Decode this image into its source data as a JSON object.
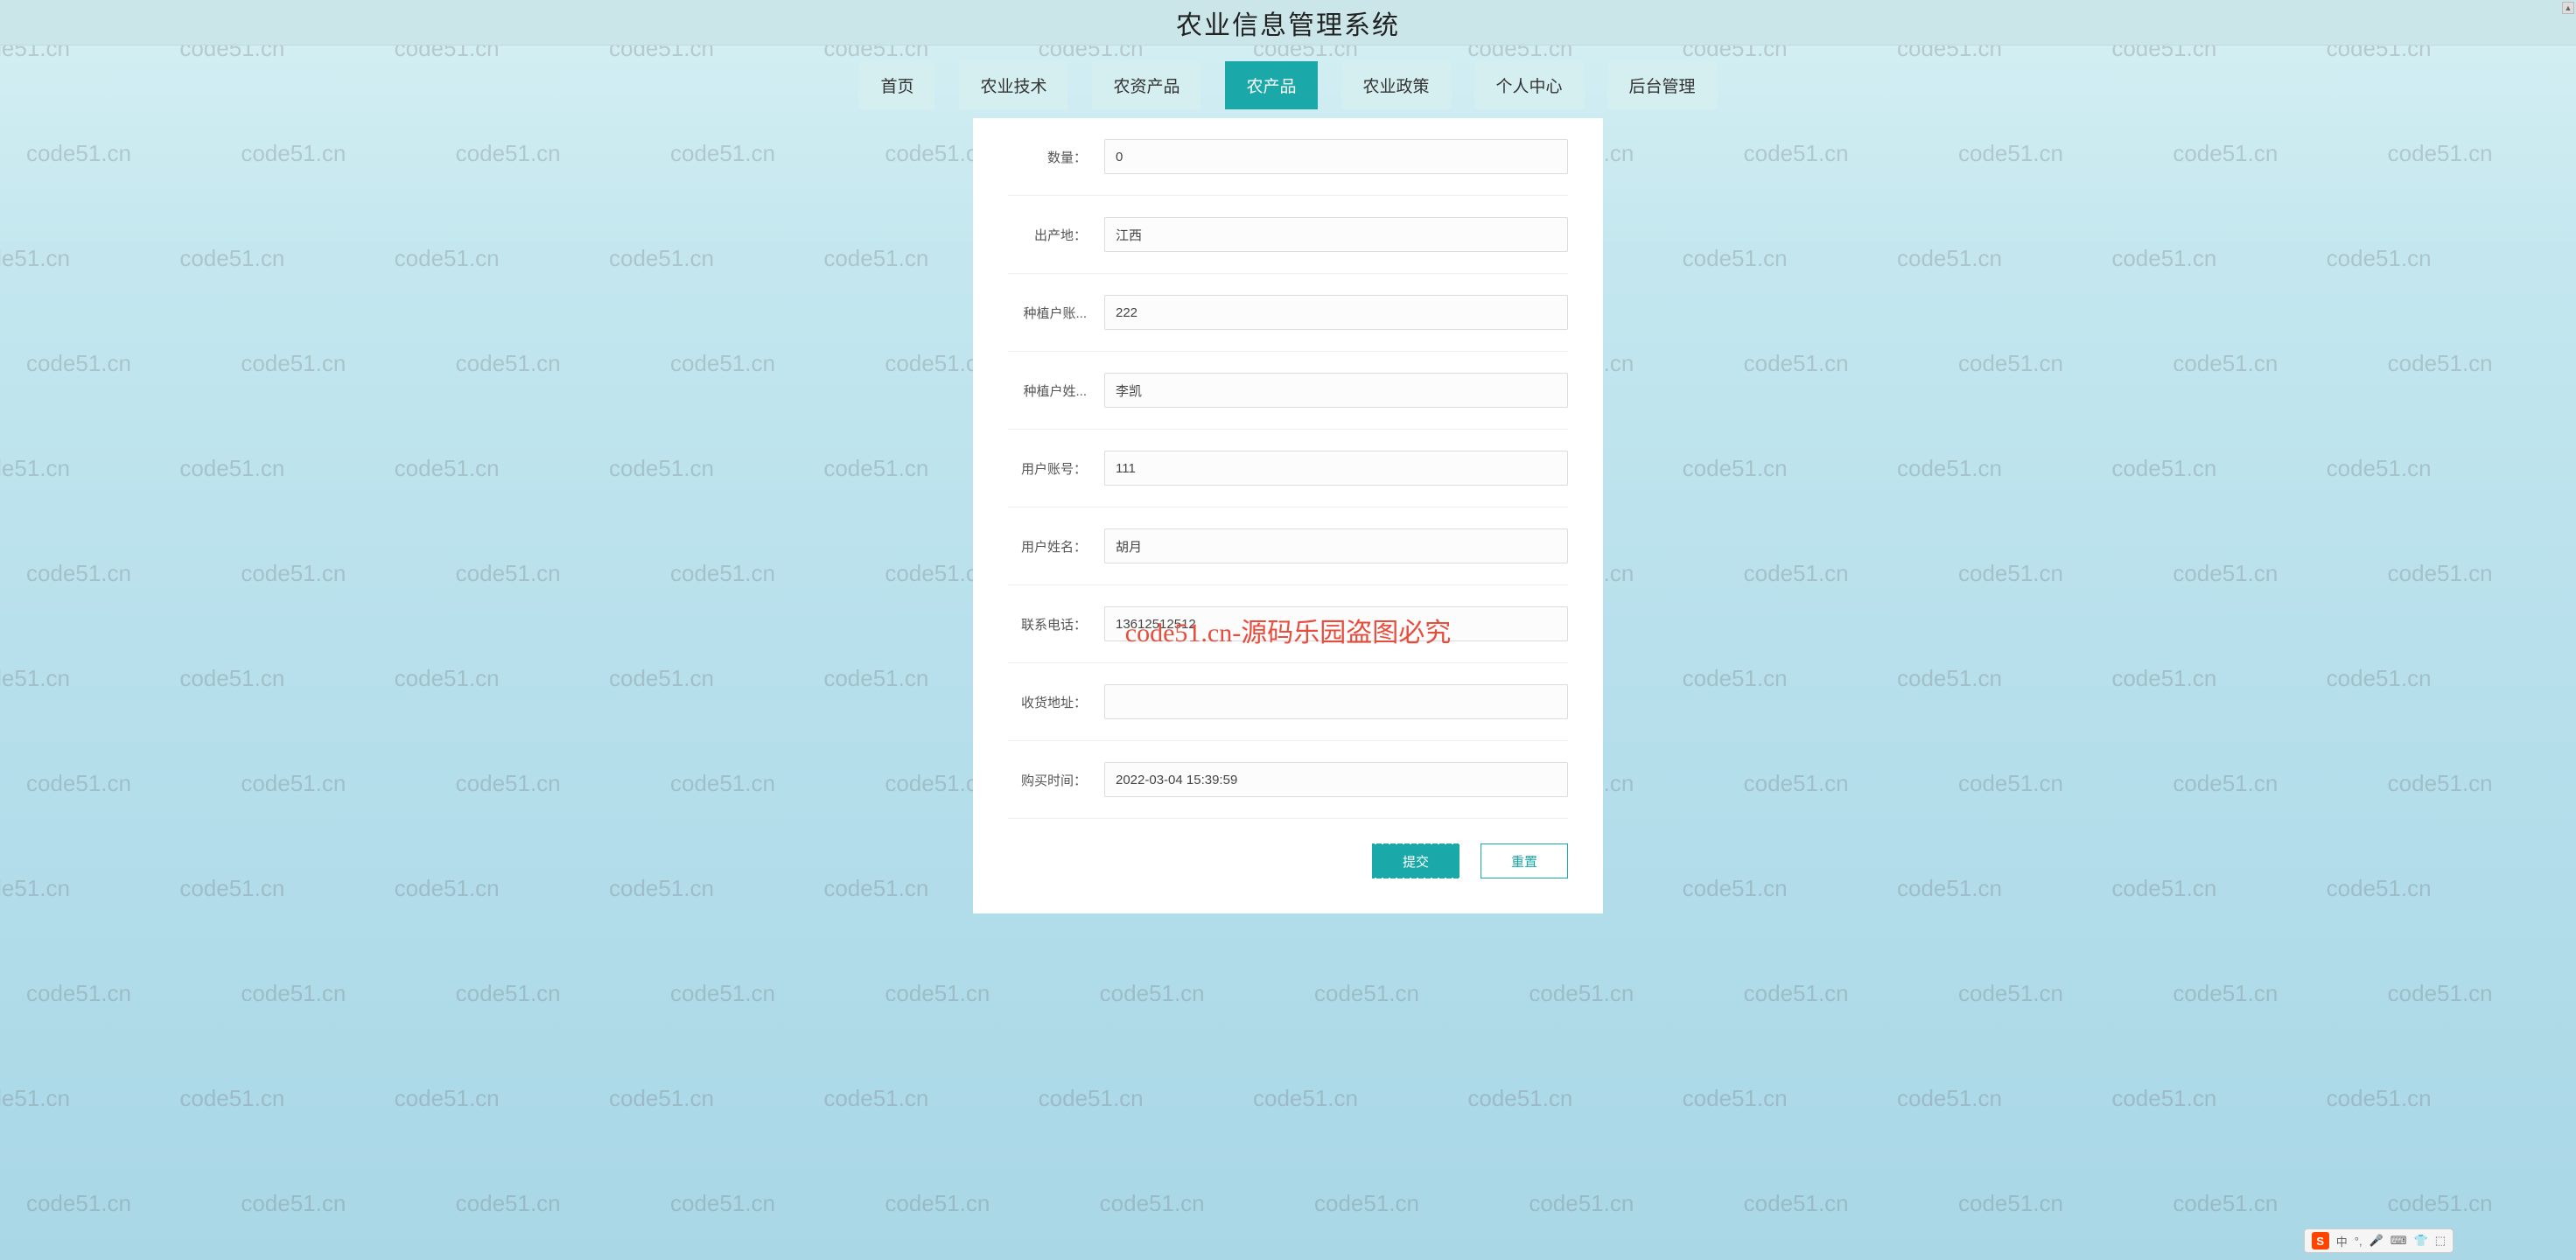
{
  "header": {
    "title": "农业信息管理系统"
  },
  "nav": {
    "items": [
      {
        "label": "首页"
      },
      {
        "label": "农业技术"
      },
      {
        "label": "农资产品"
      },
      {
        "label": "农产品",
        "active": true
      },
      {
        "label": "农业政策"
      },
      {
        "label": "个人中心"
      },
      {
        "label": "后台管理"
      }
    ]
  },
  "form": {
    "fields": [
      {
        "label": "数量：",
        "value": "0"
      },
      {
        "label": "出产地：",
        "value": "江西"
      },
      {
        "label": "种植户账...",
        "value": "222"
      },
      {
        "label": "种植户姓...",
        "value": "李凯"
      },
      {
        "label": "用户账号：",
        "value": "111"
      },
      {
        "label": "用户姓名：",
        "value": "胡月"
      },
      {
        "label": "联系电话：",
        "value": "13612512512"
      },
      {
        "label": "收货地址：",
        "value": ""
      },
      {
        "label": "购买时间：",
        "value": "2022-03-04 15:39:59"
      }
    ],
    "submit_label": "提交",
    "reset_label": "重置"
  },
  "watermark": {
    "text": "code51.cn",
    "center": "code51.cn-源码乐园盗图必究"
  },
  "ime": {
    "logo": "S",
    "lang": "中",
    "icons": [
      "°,",
      "🎤",
      "⌨",
      "👕",
      "⬚"
    ]
  }
}
